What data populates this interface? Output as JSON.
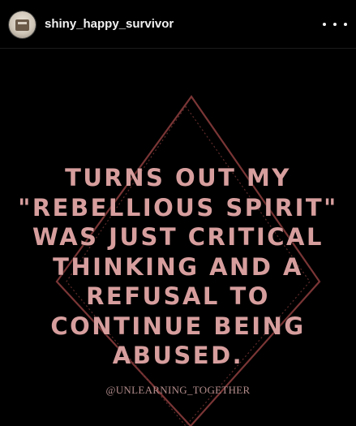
{
  "post_header": {
    "username": "shiny_happy_survivor",
    "avatar_icon": "profile-photo",
    "more_icon": "more-options-icon"
  },
  "post_image": {
    "quote_lines": [
      "TURNS OUT MY",
      "\"REBELLIOUS SPIRIT\"",
      "WAS JUST CRITICAL",
      "THINKING AND A",
      "REFUSAL TO",
      "CONTINUE BEING",
      "ABUSED."
    ],
    "credit": "@UNLEARNING_TOGETHER",
    "text_color": "#d79e9e",
    "frame_color": "#7a3535",
    "background_color": "#000000"
  }
}
